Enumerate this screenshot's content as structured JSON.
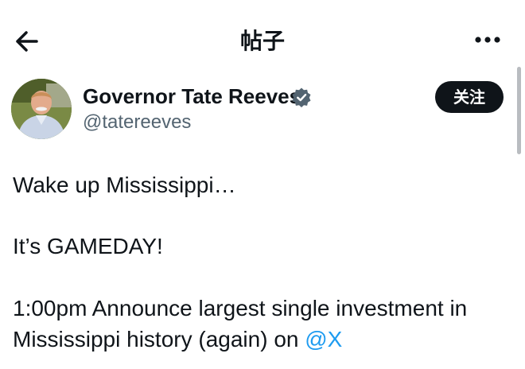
{
  "header": {
    "title": "帖子",
    "back_icon": "arrow-left-icon",
    "more_icon": "more-horizontal-icon"
  },
  "author": {
    "name": "Governor Tate Reeves",
    "handle": "@tatereeves",
    "verified_icon": "verified-badge-icon",
    "verified_color": "#536471"
  },
  "follow_button": {
    "label": "关注"
  },
  "tweet": {
    "line1": "Wake up Mississippi…",
    "line2": "It’s GAMEDAY!",
    "line3": "1:00pm Announce largest single investment in",
    "line4_text": "Mississippi history (again) on ",
    "line4_mention": "@X"
  },
  "colors": {
    "text": "#0f1419",
    "secondary": "#536471",
    "link": "#1d9bf0",
    "button_bg": "#0f1419"
  }
}
